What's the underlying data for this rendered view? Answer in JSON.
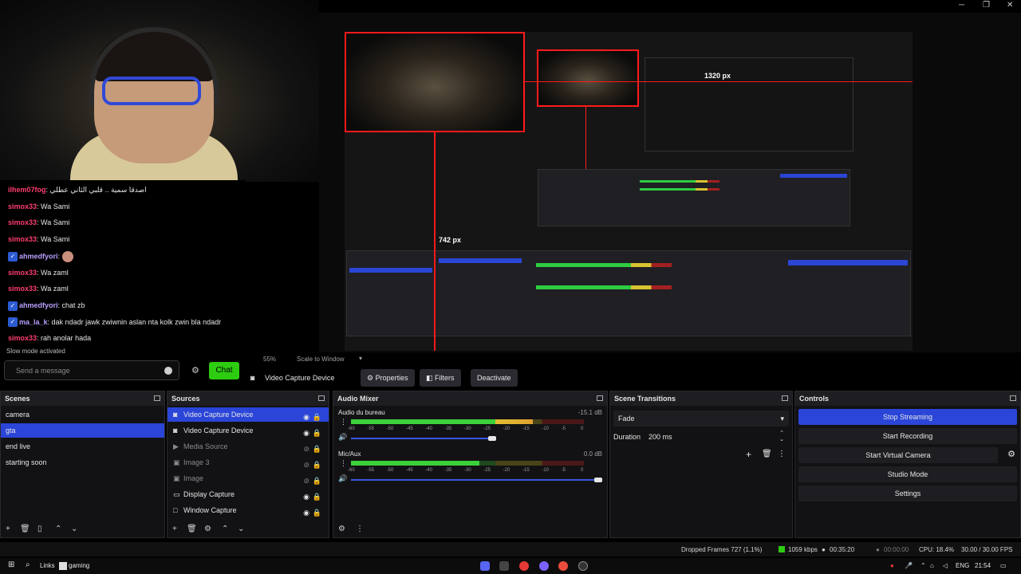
{
  "chat": {
    "messages": [
      {
        "user": "ilhem07fog",
        "text": "اصدقا سمية .. قلبي الثاني عطلي",
        "badge": false
      },
      {
        "user": "simox33",
        "text": "Wa Sami",
        "badge": false
      },
      {
        "user": "simox33",
        "text": "Wa Sami",
        "badge": false
      },
      {
        "user": "simox33",
        "text": "Wa Sami",
        "badge": false
      },
      {
        "user": "ahmedfyori",
        "text": "",
        "badge": true
      },
      {
        "user": "simox33",
        "text": "Wa zaml",
        "badge": false
      },
      {
        "user": "simox33",
        "text": "Wa zaml",
        "badge": false
      },
      {
        "user": "ahmedfyori",
        "text": "chat zb",
        "badge": true
      },
      {
        "user": "ma_la_k",
        "text": "dak ndadr jawk zwiwnin aslan nta kolk zwin bla ndadr",
        "badge": true
      },
      {
        "user": "simox33",
        "text": "rah anolar hada",
        "badge": false
      }
    ],
    "slow_mode": "Slow mode activated",
    "input_placeholder": "Send a message",
    "chat_button": "Chat"
  },
  "preview": {
    "dim_label": "742 px",
    "dim_label_2": "1320 px"
  },
  "zoom_bar": {
    "zoom": "55%",
    "scale_mode": "Scale to Window"
  },
  "source_toolbar": {
    "source_name": "Video Capture Device",
    "properties": "Properties",
    "filters": "Filters",
    "deactivate": "Deactivate"
  },
  "scenes": {
    "title": "Scenes",
    "items": [
      {
        "label": "camera",
        "selected": false
      },
      {
        "label": "gta",
        "selected": true
      },
      {
        "label": "end live",
        "selected": false
      },
      {
        "label": "starting soon",
        "selected": false
      }
    ]
  },
  "sources": {
    "title": "Sources",
    "items": [
      {
        "label": "Video Capture Device",
        "selected": true,
        "hidden": false,
        "icon": "camera-icon"
      },
      {
        "label": "Video Capture Device",
        "selected": false,
        "hidden": false,
        "icon": "camera-icon"
      },
      {
        "label": "Media Source",
        "selected": false,
        "hidden": true,
        "icon": "play-icon"
      },
      {
        "label": "Image 3",
        "selected": false,
        "hidden": true,
        "icon": "image-icon"
      },
      {
        "label": "Image",
        "selected": false,
        "hidden": true,
        "icon": "image-icon"
      },
      {
        "label": "Display Capture",
        "selected": false,
        "hidden": false,
        "icon": "monitor-icon"
      },
      {
        "label": "Window Capture",
        "selected": false,
        "hidden": false,
        "icon": "window-icon"
      }
    ]
  },
  "audio_mixer": {
    "title": "Audio Mixer",
    "channels": [
      {
        "name": "Audio du bureau",
        "db": "-15.1 dB",
        "level": 0.78
      },
      {
        "name": "Mic/Aux",
        "db": "0.0 dB",
        "level": 0.55
      }
    ],
    "scale": [
      "-60",
      "-55",
      "-50",
      "-45",
      "-40",
      "-35",
      "-30",
      "-25",
      "-20",
      "-15",
      "-10",
      "-5",
      "0"
    ]
  },
  "scene_transitions": {
    "title": "Scene Transitions",
    "transition": "Fade",
    "duration_label": "Duration",
    "duration_value": "200 ms"
  },
  "controls": {
    "title": "Controls",
    "buttons": [
      "Stop Streaming",
      "Start Recording",
      "Start Virtual Camera",
      "Studio Mode",
      "Settings"
    ]
  },
  "status": {
    "dropped_frames": "Dropped Frames 727 (1.1%)",
    "bitrate": "1059 kbps",
    "stream_time": "00:35:20",
    "rec_time": "00:00:00",
    "cpu": "CPU: 18.4%",
    "fps": "30.00 / 30.00 FPS"
  },
  "taskbar": {
    "links_label": "Links",
    "gaming_label": "gaming",
    "lang": "ENG",
    "time": "21:54"
  },
  "colors": {
    "accent": "#2a45d8",
    "live_green": "#2ecc11",
    "selection_red": "#ff1a1a"
  }
}
